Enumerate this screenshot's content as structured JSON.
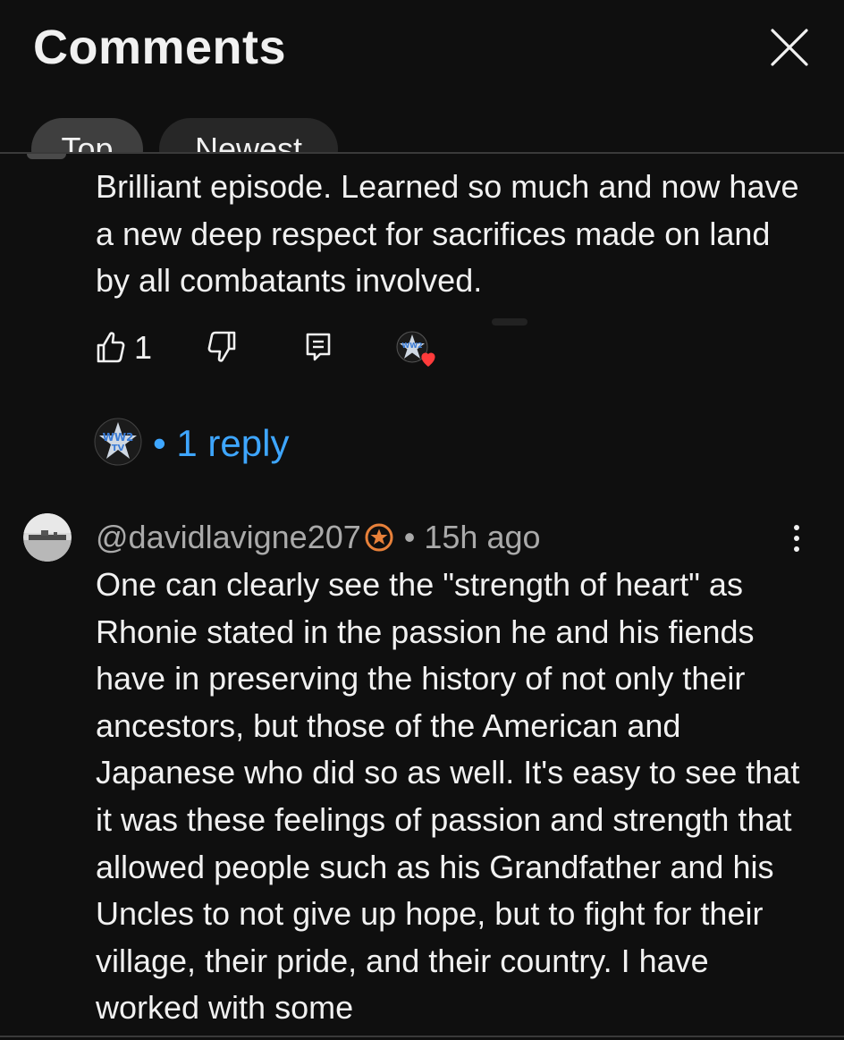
{
  "header": {
    "title": "Comments",
    "close_icon": "close-icon",
    "chips": [
      {
        "label": "Top",
        "selected": true
      },
      {
        "label": "Newest",
        "selected": false
      }
    ]
  },
  "comments": [
    {
      "text": "Brilliant episode. Learned so much and now have a new deep respect for sacrifices made on land by all combatants involved.",
      "likes": "1",
      "actions": [
        "like-icon",
        "dislike-icon",
        "reply-icon",
        "creator-heart-icon"
      ],
      "replies_label": "1 reply",
      "replies_separator": "•"
    },
    {
      "handle": "@davidlavigne207",
      "separator": "•",
      "time": "15h ago",
      "badge_icon": "member-badge-icon",
      "more_icon": "more-vert-icon",
      "text": "One can clearly see the \"strength of heart\" as Rhonie stated in the passion he and his fiends have in preserving the history of not only their ancestors, but those of the American and Japanese who did so as well. It's easy to see that it was these feelings of passion and strength that allowed people such as his Grandfather and his Uncles to not give up hope, but to fight for their village, their pride, and their country. I have worked with some"
    }
  ],
  "colors": {
    "background": "#0f0f0f",
    "text": "#f1f1f1",
    "secondary_text": "#aaaaaa",
    "link": "#3ea6ff",
    "heart": "#ff3b3b",
    "badge": "#e8813a"
  }
}
